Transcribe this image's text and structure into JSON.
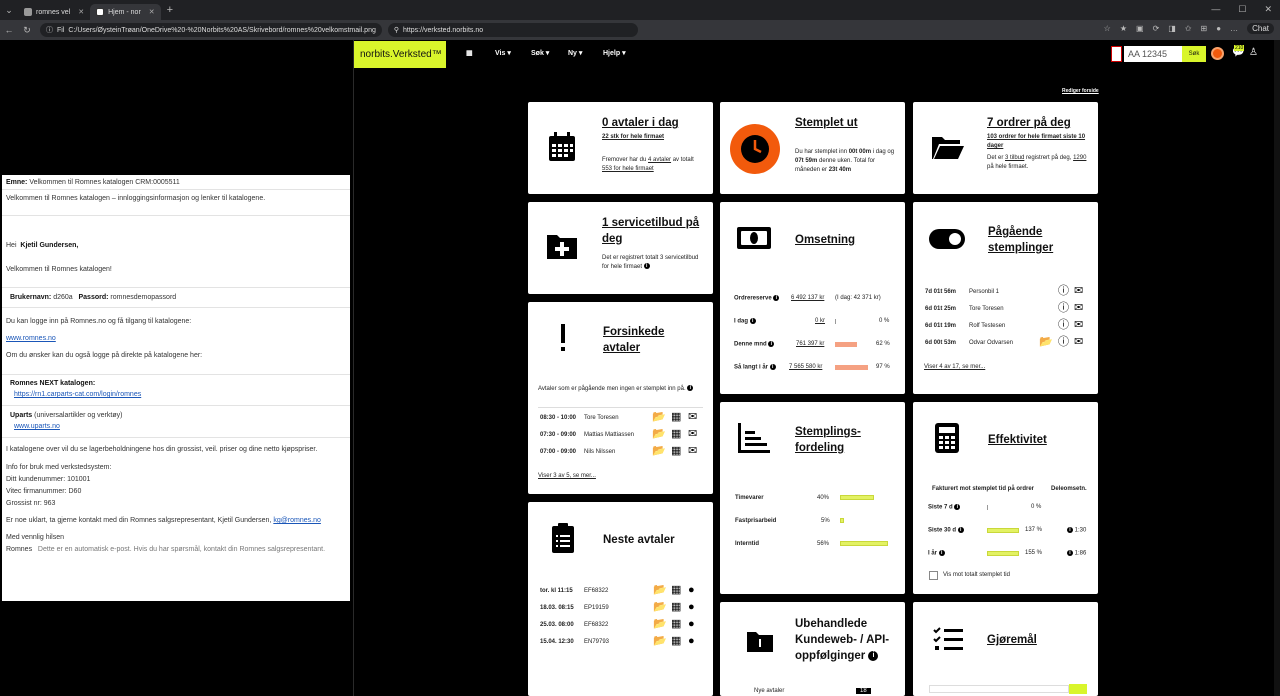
{
  "browser": {
    "tabs": [
      {
        "label": "romnes vel"
      },
      {
        "label": "Hjem - nor"
      }
    ],
    "file_label": "Fil",
    "path": "C:/Users/ØysteinTrøan/OneDrive%20-%20Norbits%20AS/Skrivebord/romnes%20velkomstmail.png",
    "url": "https://verksted.norbits.no",
    "chat_label": "Chat"
  },
  "email": {
    "subject_label": "Emne:",
    "subject": "Velkommen til Romnes katalogen CRM:0005511",
    "intro": "Velkommen til Romnes katalogen – innloggingsinformasjon og lenker til katalogene.",
    "greeting_prefix": "Hei",
    "greeting_name": "Kjetil Gundersen,",
    "welcome": "Velkommen til Romnes katalogen!",
    "username_label": "Brukernavn:",
    "username": "d260a",
    "password_label": "Passord:",
    "password": "romnesdemopassord",
    "login_text": "Du kan logge inn på Romnes.no og få tilgang til katalogene:",
    "login_link": "www.romnes.no",
    "direct_text": "Om du ønsker kan du også logge på direkte på katalogene her:",
    "next_title": "Romnes NEXT katalogen:",
    "next_link": "https://rn1.carparts-cat.com/login/romnes",
    "uparts_title": "Uparts",
    "uparts_desc": "(universalartikler og verktøy)",
    "uparts_link": "www.uparts.no",
    "catalog_text": "I katalogene over vil du se lagerbeholdningene hos din grossist, veil. priser og dine netto kjøpspriser.",
    "info_heading": "Info for bruk med verkstedsystem:",
    "customer_no": "Ditt kundenummer: 101001",
    "vitec_no": "Vitec firmanummer: D60",
    "grossist_no": "Grossist nr: 963",
    "contact_text": "Er noe uklart, ta gjerne kontakt med din Romnes salgsrepresentant, Kjetil Gundersen,",
    "contact_email": "kg@romnes.no",
    "closing": "Med vennlig hilsen",
    "sender": "Romnes",
    "auto_note": "Dette er en automatisk e-post. Hvis du har spørsmål, kontakt din Romnes salgsrepresentant."
  },
  "app": {
    "logo": "norbits.Verksted™",
    "nav": [
      "Vis",
      "Søk",
      "Ny",
      "Hjelp"
    ],
    "search_value": "AA 12345",
    "search_button": "Søk",
    "notification_count": "210",
    "edit_front": "Rediger forside",
    "accent": "#d9f52b",
    "orange": "#f25a0c"
  },
  "cards": {
    "avtaler": {
      "title": "0 avtaler i dag",
      "sub": "22 stk for hele firmaet",
      "desc1": "Fremover har du",
      "desc_link1": "4 avtaler",
      "desc2": "av totalt",
      "desc_link2": "553 for hele firmaet",
      "icon": "calendar-icon"
    },
    "stemplet": {
      "title": "Stemplet ut",
      "l1": "Du har stemplet inn",
      "v1": "00t 00m",
      "l1b": "i",
      "l2": "dag og",
      "v2": "07t 59m",
      "l2b": "denne uken. Total",
      "l3": "for måneden er",
      "v3": "23t 40m",
      "icon": "clock-icon"
    },
    "ordrer": {
      "title": "7 ordrer på deg",
      "sub": "103 ordrer for hele firmaet siste 10 dager",
      "desc1": "Det er",
      "desc_link1": "3 tilbud",
      "desc2": "registrert på deg,",
      "desc_link2": "1290",
      "desc3": "på hele firmaet.",
      "icon": "folder-icon"
    },
    "servicetilbud": {
      "title": "1 servicetilbud på deg",
      "desc": "Det er registrert totalt 3 servicetilbud for hele firmaet",
      "icon": "folder-plus-icon"
    },
    "omsetning": {
      "title": "Omsetning",
      "rows": [
        {
          "label": "Ordrereserve",
          "value": "6 492 137 kr",
          "extra": "(I dag: 42 371 kr)",
          "pct": "",
          "fill": 0
        },
        {
          "label": "I dag",
          "value": "0 kr",
          "extra": "",
          "pct": "0 %",
          "fill": 0
        },
        {
          "label": "Denne mnd",
          "value": "761 397 kr",
          "extra": "",
          "pct": "62 %",
          "fill": 0.62
        },
        {
          "label": "Så langt i år",
          "value": "7 565 580 kr",
          "extra": "",
          "pct": "97 %",
          "fill": 0.97
        }
      ],
      "icon": "money-icon"
    },
    "pagaende": {
      "title": "Pågående stemplinger",
      "rows": [
        {
          "time": "7d 01t 56m",
          "name": "Personbil 1"
        },
        {
          "time": "6d 01t 25m",
          "name": "Tore Toresen"
        },
        {
          "time": "6d 01t 19m",
          "name": "Rolf Testesen"
        },
        {
          "time": "6d 00t 53m",
          "name": "Odvar Odvarsen"
        }
      ],
      "link": "Viser 4 av 17, se mer...",
      "icon": "toggle-icon"
    },
    "forsinkede": {
      "title": "Forsinkede avtaler",
      "desc": "Avtaler som er pågående men ingen er stemplet inn på.",
      "rows": [
        {
          "time": "08:30 - 10:00",
          "name": "Tore Toresen"
        },
        {
          "time": "07:30 - 09:00",
          "name": "Mattias Mattiassen"
        },
        {
          "time": "07:00 - 09:00",
          "name": "Nils Nilssen"
        }
      ],
      "link": "Viser 3 av 5, se mer...",
      "icon": "exclamation-icon"
    },
    "stemplingsfordeling": {
      "title": "Stemplings-fordeling",
      "rows": [
        {
          "label": "Timevarer",
          "pct": "40%",
          "fill": 0.4
        },
        {
          "label": "Fastprisarbeid",
          "pct": "5%",
          "fill": 0.05
        },
        {
          "label": "Interntid",
          "pct": "56%",
          "fill": 0.56
        }
      ],
      "icon": "bar-chart-icon"
    },
    "effektivitet": {
      "title": "Effektivitet",
      "col1": "Fakturert mot stemplet tid på ordrer",
      "col2": "Deleomsetn.",
      "rows": [
        {
          "label": "Siste 7 d",
          "pct": "0 %",
          "right": "",
          "fill": 0
        },
        {
          "label": "Siste 30 d",
          "pct": "137 %",
          "right": "1:30",
          "fill": 1
        },
        {
          "label": "I år",
          "pct": "155 %",
          "right": "1:86",
          "fill": 1
        }
      ],
      "checkbox_label": "Vis mot totalt stemplet tid",
      "icon": "calculator-icon"
    },
    "neste": {
      "title": "Neste avtaler",
      "rows": [
        {
          "date": "tor. kl 11:15",
          "code": "EF68322"
        },
        {
          "date": "18.03. 08:15",
          "code": "EP19159"
        },
        {
          "date": "25.03. 08:00",
          "code": "EF68322"
        },
        {
          "date": "15.04. 12:30",
          "code": "EN79793"
        }
      ],
      "icon": "clipboard-icon"
    },
    "ubehandlede": {
      "title": "Ubehandlede Kundeweb- / API-oppfølginger",
      "sub": "Nye avtaler",
      "count": "18",
      "icon": "folder-badge-icon"
    },
    "gjoremal": {
      "title": "Gjøremål",
      "icon": "checklist-icon"
    }
  }
}
